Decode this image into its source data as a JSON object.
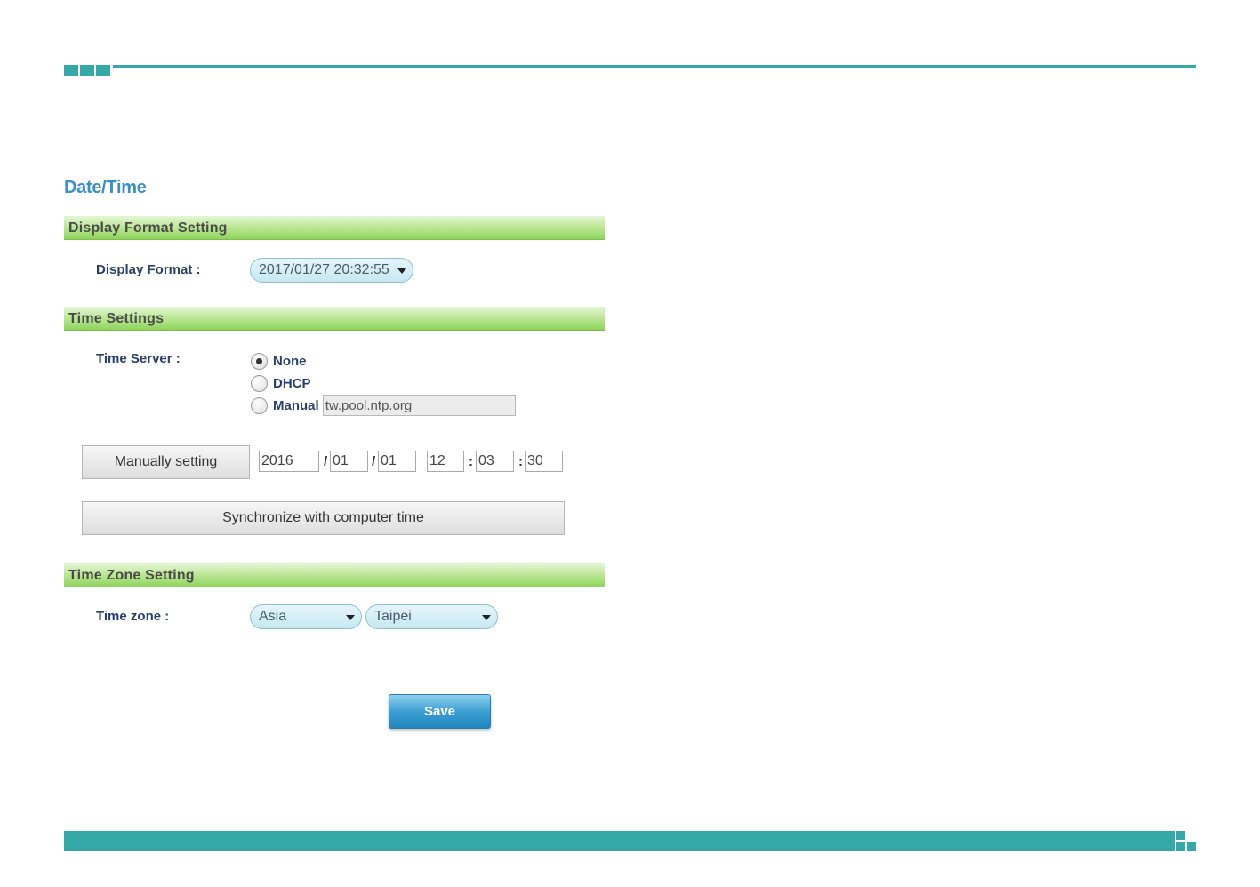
{
  "page": {
    "title": "Date/Time"
  },
  "display_format": {
    "section_title": "Display Format Setting",
    "label": "Display Format :",
    "selected": "2017/01/27 20:32:55"
  },
  "time_settings": {
    "section_title": "Time Settings",
    "server_label": "Time Server :",
    "options": [
      {
        "label": "None",
        "checked": true
      },
      {
        "label": "DHCP",
        "checked": false
      },
      {
        "label": "Manual",
        "checked": false
      }
    ],
    "manual_server_value": "tw.pool.ntp.org",
    "manual_button": "Manually setting",
    "year": "2016",
    "month": "01",
    "day": "01",
    "hour": "12",
    "minute": "03",
    "second": "30",
    "date_sep": "/",
    "time_sep": ":",
    "sync_button": "Synchronize with computer time"
  },
  "time_zone": {
    "section_title": "Time Zone Setting",
    "label": "Time zone :",
    "region": "Asia",
    "city": "Taipei"
  },
  "save_label": "Save",
  "colors": {
    "accent_teal": "#35a8a8",
    "title_blue": "#3a8fc9",
    "section_green": "#8fd45c",
    "save_blue": "#2186c0"
  }
}
